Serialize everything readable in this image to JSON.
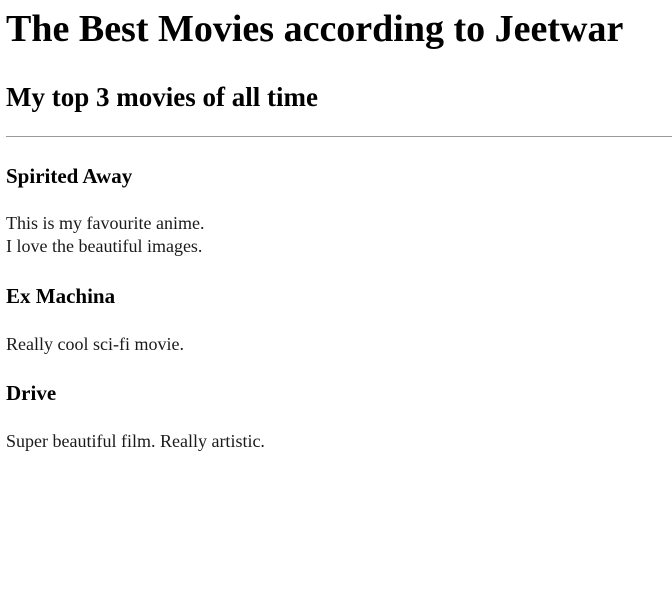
{
  "page": {
    "title": "The Best Movies according to Jeetwar",
    "subtitle": "My top 3 movies of all time"
  },
  "movies": [
    {
      "title": "Spirited Away",
      "description_lines": [
        "This is my favourite anime.",
        "I love the beautiful images."
      ]
    },
    {
      "title": "Ex Machina",
      "description_lines": [
        "Really cool sci-fi movie."
      ]
    },
    {
      "title": "Drive",
      "description_lines": [
        "Super beautiful film. Really artistic."
      ]
    }
  ]
}
